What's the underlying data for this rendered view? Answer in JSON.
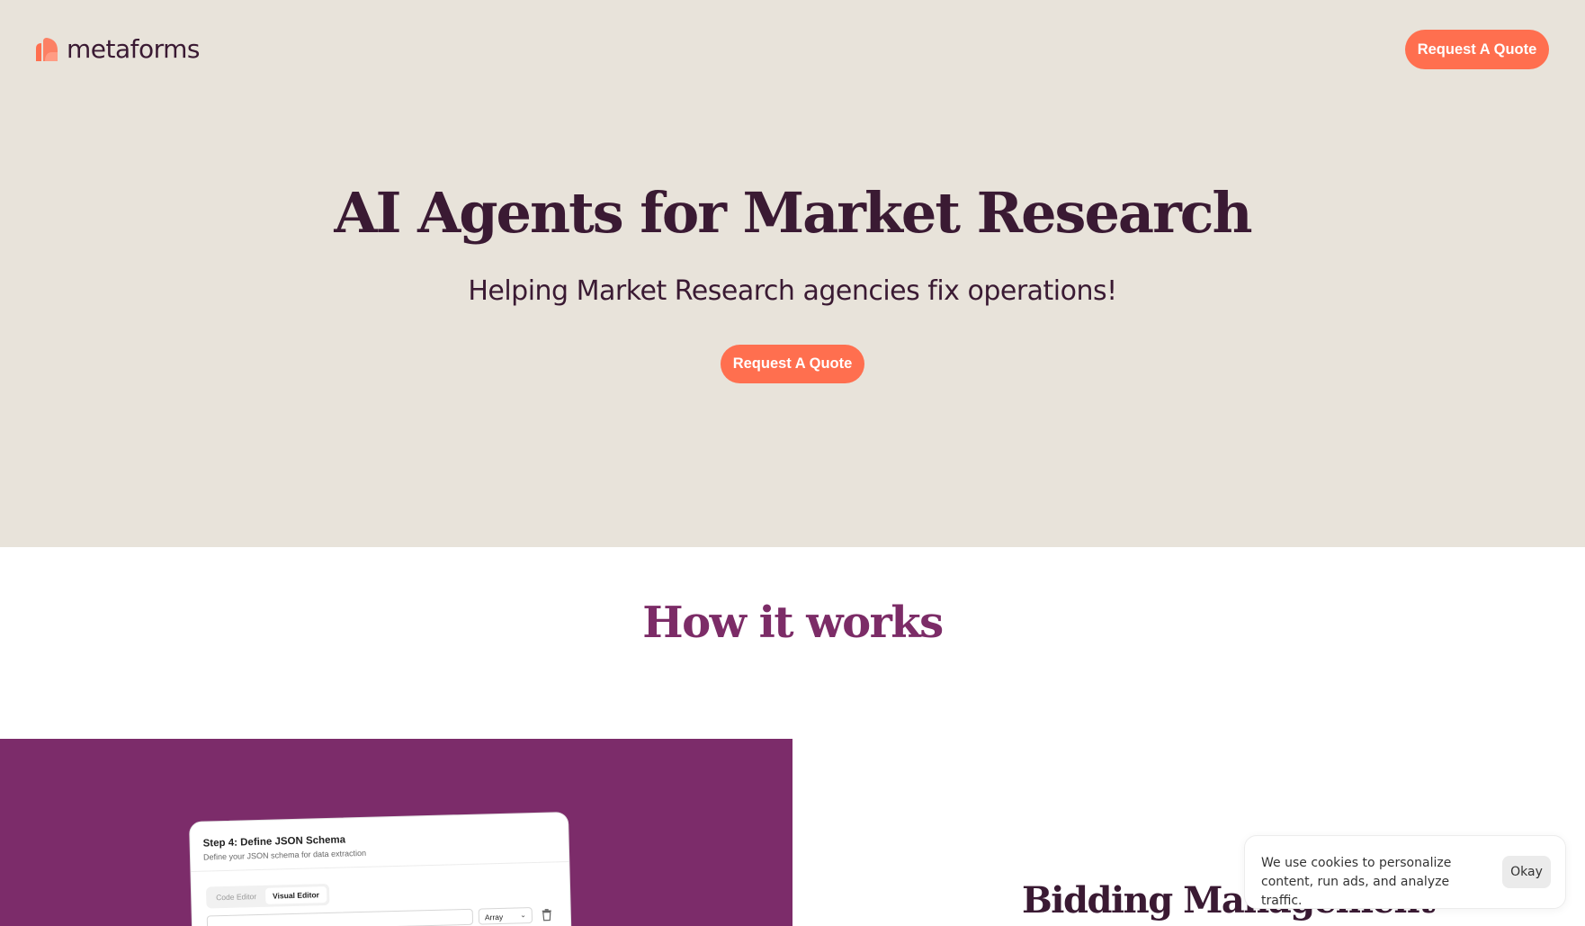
{
  "header": {
    "logo_text": "metaforms",
    "cta_label": "Request A Quote"
  },
  "hero": {
    "title": "AI Agents for Market Research",
    "subtitle": "Helping Market Research agencies fix operations!",
    "cta_label": "Request A Quote"
  },
  "how_it_works": {
    "title": "How it works"
  },
  "mockup": {
    "step_title": "Step 4: Define JSON Schema",
    "step_desc": "Define your JSON schema for data extraction",
    "tabs": [
      {
        "label": "Code Editor"
      },
      {
        "label": "Visual Editor"
      }
    ],
    "type_select": "Array"
  },
  "feature": {
    "title": "Bidding Management"
  },
  "cookie_banner": {
    "text": "We use cookies to personalize content, run ads, and analyze traffic.",
    "button_label": "Okay"
  },
  "colors": {
    "hero_bg": "#e8e3da",
    "accent_orange": "#ff6f4f",
    "dark_plum": "#3a1a33",
    "purple": "#7c2c6a"
  },
  "icons": [
    "logo-mark-icon",
    "chevron-down-icon",
    "trash-icon"
  ]
}
